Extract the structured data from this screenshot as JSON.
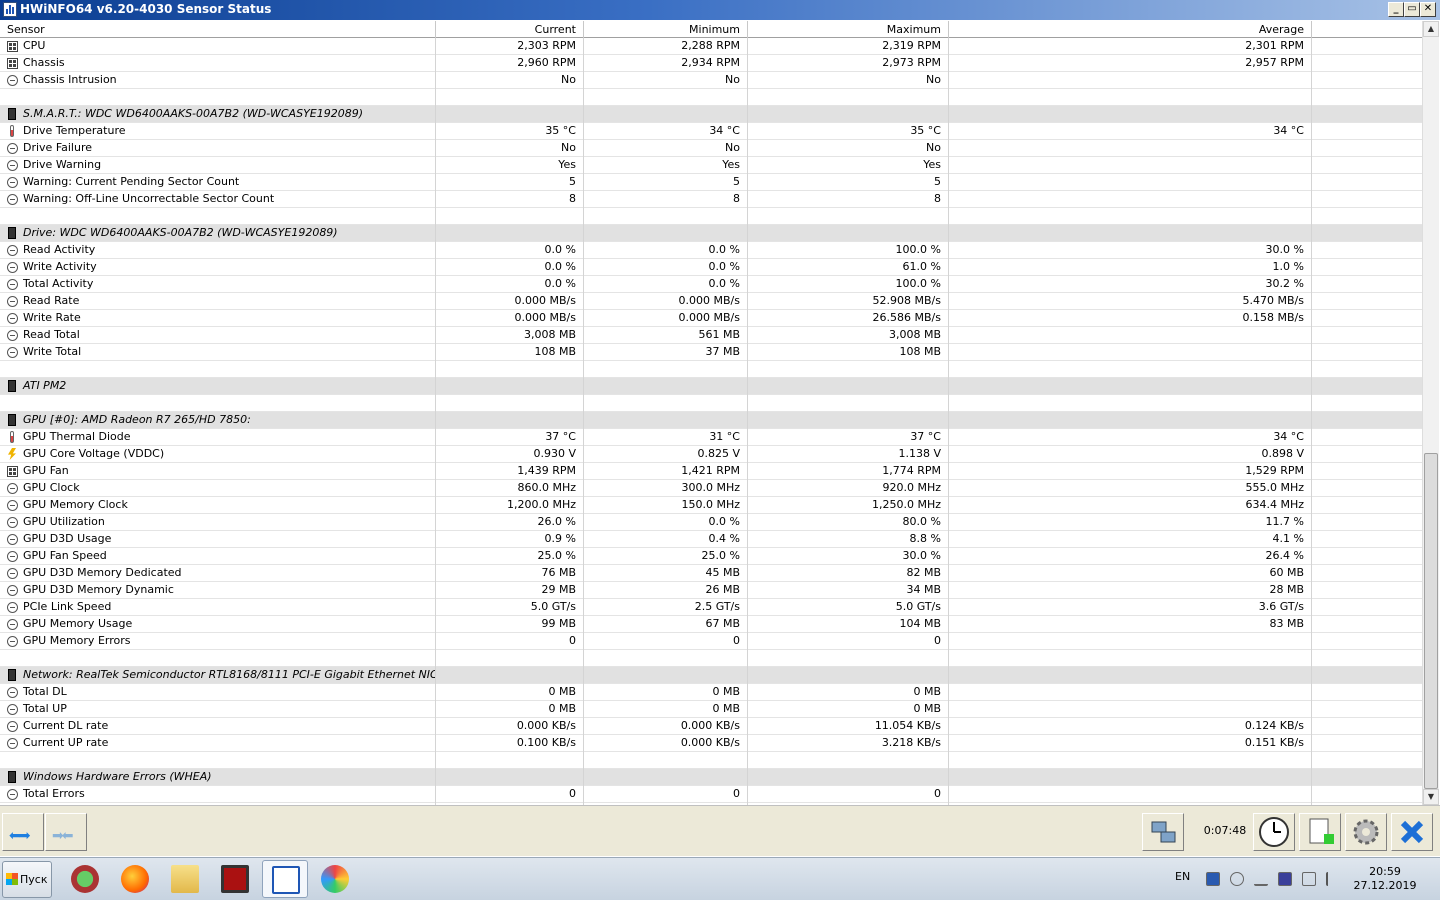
{
  "window": {
    "title": "HWiNFO64 v6.20-4030 Sensor Status"
  },
  "columns": [
    "Sensor",
    "Current",
    "Minimum",
    "Maximum",
    "Average"
  ],
  "rows": [
    {
      "type": "sensor",
      "icon": "fan",
      "label": "CPU",
      "cur": "2,303 RPM",
      "min": "2,288 RPM",
      "max": "2,319 RPM",
      "avg": "2,301 RPM"
    },
    {
      "type": "sensor",
      "icon": "fan",
      "label": "Chassis",
      "cur": "2,960 RPM",
      "min": "2,934 RPM",
      "max": "2,973 RPM",
      "avg": "2,957 RPM"
    },
    {
      "type": "sensor",
      "icon": "gauge",
      "label": "Chassis Intrusion",
      "cur": "No",
      "min": "No",
      "max": "No",
      "avg": ""
    },
    {
      "type": "blank"
    },
    {
      "type": "group",
      "label": "S.M.A.R.T.: WDC WD6400AAKS-00A7B2 (WD-WCASYE192089)"
    },
    {
      "type": "sensor",
      "icon": "thermo",
      "label": "Drive Temperature",
      "cur": "35 °C",
      "min": "34 °C",
      "max": "35 °C",
      "avg": "34 °C"
    },
    {
      "type": "sensor",
      "icon": "gauge",
      "label": "Drive Failure",
      "cur": "No",
      "min": "No",
      "max": "No",
      "avg": ""
    },
    {
      "type": "sensor",
      "icon": "gauge",
      "label": "Drive Warning",
      "cur": "Yes",
      "min": "Yes",
      "max": "Yes",
      "avg": ""
    },
    {
      "type": "sensor",
      "icon": "gauge",
      "label": "Warning: Current Pending Sector Count",
      "cur": "5",
      "min": "5",
      "max": "5",
      "avg": ""
    },
    {
      "type": "sensor",
      "icon": "gauge",
      "label": "Warning: Off-Line Uncorrectable Sector Count",
      "cur": "8",
      "min": "8",
      "max": "8",
      "avg": ""
    },
    {
      "type": "blank"
    },
    {
      "type": "group",
      "label": "Drive: WDC WD6400AAKS-00A7B2 (WD-WCASYE192089)"
    },
    {
      "type": "sensor",
      "icon": "gauge",
      "label": "Read Activity",
      "cur": "0.0 %",
      "min": "0.0 %",
      "max": "100.0 %",
      "avg": "30.0 %"
    },
    {
      "type": "sensor",
      "icon": "gauge",
      "label": "Write Activity",
      "cur": "0.0 %",
      "min": "0.0 %",
      "max": "61.0 %",
      "avg": "1.0 %"
    },
    {
      "type": "sensor",
      "icon": "gauge",
      "label": "Total Activity",
      "cur": "0.0 %",
      "min": "0.0 %",
      "max": "100.0 %",
      "avg": "30.2 %"
    },
    {
      "type": "sensor",
      "icon": "gauge",
      "label": "Read Rate",
      "cur": "0.000 MB/s",
      "min": "0.000 MB/s",
      "max": "52.908 MB/s",
      "avg": "5.470 MB/s"
    },
    {
      "type": "sensor",
      "icon": "gauge",
      "label": "Write Rate",
      "cur": "0.000 MB/s",
      "min": "0.000 MB/s",
      "max": "26.586 MB/s",
      "avg": "0.158 MB/s"
    },
    {
      "type": "sensor",
      "icon": "gauge",
      "label": "Read Total",
      "cur": "3,008 MB",
      "min": "561 MB",
      "max": "3,008 MB",
      "avg": ""
    },
    {
      "type": "sensor",
      "icon": "gauge",
      "label": "Write Total",
      "cur": "108 MB",
      "min": "37 MB",
      "max": "108 MB",
      "avg": ""
    },
    {
      "type": "blank"
    },
    {
      "type": "group",
      "label": "ATI PM2"
    },
    {
      "type": "blank"
    },
    {
      "type": "group",
      "label": "GPU [#0]: AMD Radeon R7 265/HD 7850:"
    },
    {
      "type": "sensor",
      "icon": "thermo",
      "label": "GPU Thermal Diode",
      "cur": "37 °C",
      "min": "31 °C",
      "max": "37 °C",
      "avg": "34 °C"
    },
    {
      "type": "sensor",
      "icon": "volt",
      "label": "GPU Core Voltage (VDDC)",
      "cur": "0.930 V",
      "min": "0.825 V",
      "max": "1.138 V",
      "avg": "0.898 V"
    },
    {
      "type": "sensor",
      "icon": "fan",
      "label": "GPU Fan",
      "cur": "1,439 RPM",
      "min": "1,421 RPM",
      "max": "1,774 RPM",
      "avg": "1,529 RPM"
    },
    {
      "type": "sensor",
      "icon": "gauge",
      "label": "GPU Clock",
      "cur": "860.0 MHz",
      "min": "300.0 MHz",
      "max": "920.0 MHz",
      "avg": "555.0 MHz"
    },
    {
      "type": "sensor",
      "icon": "gauge",
      "label": "GPU Memory Clock",
      "cur": "1,200.0 MHz",
      "min": "150.0 MHz",
      "max": "1,250.0 MHz",
      "avg": "634.4 MHz"
    },
    {
      "type": "sensor",
      "icon": "gauge",
      "label": "GPU Utilization",
      "cur": "26.0 %",
      "min": "0.0 %",
      "max": "80.0 %",
      "avg": "11.7 %"
    },
    {
      "type": "sensor",
      "icon": "gauge",
      "label": "GPU D3D Usage",
      "cur": "0.9 %",
      "min": "0.4 %",
      "max": "8.8 %",
      "avg": "4.1 %"
    },
    {
      "type": "sensor",
      "icon": "gauge",
      "label": "GPU Fan Speed",
      "cur": "25.0 %",
      "min": "25.0 %",
      "max": "30.0 %",
      "avg": "26.4 %"
    },
    {
      "type": "sensor",
      "icon": "gauge",
      "label": "GPU D3D Memory Dedicated",
      "cur": "76 MB",
      "min": "45 MB",
      "max": "82 MB",
      "avg": "60 MB"
    },
    {
      "type": "sensor",
      "icon": "gauge",
      "label": "GPU D3D Memory Dynamic",
      "cur": "29 MB",
      "min": "26 MB",
      "max": "34 MB",
      "avg": "28 MB"
    },
    {
      "type": "sensor",
      "icon": "gauge",
      "label": "PCIe Link Speed",
      "cur": "5.0 GT/s",
      "min": "2.5 GT/s",
      "max": "5.0 GT/s",
      "avg": "3.6 GT/s"
    },
    {
      "type": "sensor",
      "icon": "gauge",
      "label": "GPU Memory Usage",
      "cur": "99 MB",
      "min": "67 MB",
      "max": "104 MB",
      "avg": "83 MB"
    },
    {
      "type": "sensor",
      "icon": "gauge",
      "label": "GPU Memory Errors",
      "cur": "0",
      "min": "0",
      "max": "0",
      "avg": ""
    },
    {
      "type": "blank"
    },
    {
      "type": "group",
      "label": "Network: RealTek Semiconductor RTL8168/8111 PCI-E Gigabit Ethernet NIC"
    },
    {
      "type": "sensor",
      "icon": "gauge",
      "label": "Total DL",
      "cur": "0 MB",
      "min": "0 MB",
      "max": "0 MB",
      "avg": ""
    },
    {
      "type": "sensor",
      "icon": "gauge",
      "label": "Total UP",
      "cur": "0 MB",
      "min": "0 MB",
      "max": "0 MB",
      "avg": ""
    },
    {
      "type": "sensor",
      "icon": "gauge",
      "label": "Current DL rate",
      "cur": "0.000 KB/s",
      "min": "0.000 KB/s",
      "max": "11.054 KB/s",
      "avg": "0.124 KB/s"
    },
    {
      "type": "sensor",
      "icon": "gauge",
      "label": "Current UP rate",
      "cur": "0.100 KB/s",
      "min": "0.000 KB/s",
      "max": "3.218 KB/s",
      "avg": "0.151 KB/s"
    },
    {
      "type": "blank"
    },
    {
      "type": "group",
      "label": "Windows Hardware Errors (WHEA)"
    },
    {
      "type": "sensor",
      "icon": "gauge",
      "label": "Total Errors",
      "cur": "0",
      "min": "0",
      "max": "0",
      "avg": ""
    }
  ],
  "toolbar": {
    "timer": "0:07:48"
  },
  "taskbar": {
    "start_label": "Пуск",
    "apps": [
      "app-green-icon",
      "firefox-icon",
      "folder-icon",
      "hwmon-icon",
      "hwinfo-icon",
      "paint-icon"
    ],
    "lang": "EN",
    "time": "20:59",
    "date": "27.12.2019"
  },
  "colors": {
    "title_bar": "#0a3d91",
    "group_row": "#e1e1e1",
    "taskbar": "#d2dbe6"
  }
}
